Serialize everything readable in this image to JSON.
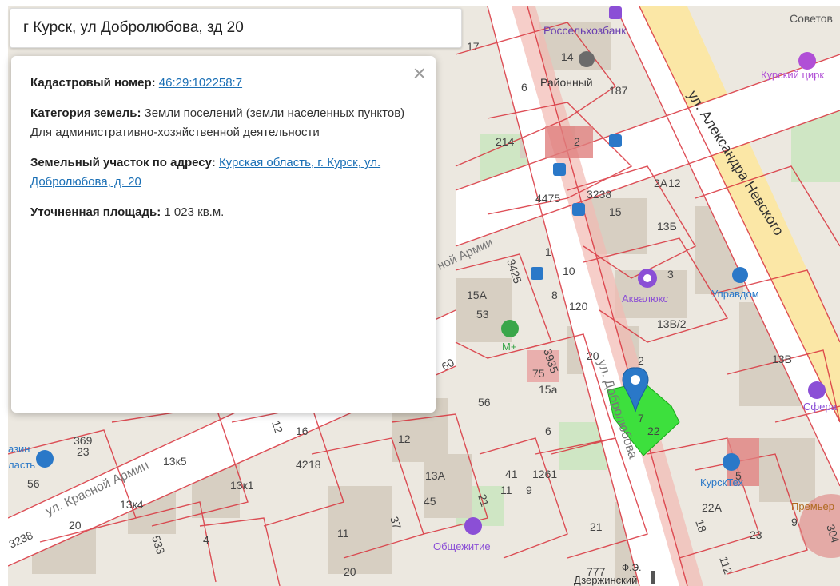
{
  "search": {
    "value": "г Курск, ул Добролюбова, зд 20"
  },
  "popup": {
    "close_symbol": "×",
    "cadastral_label": "Кадастровый номер:",
    "cadastral_value": "46:29:102258:7",
    "category_label": "Категория земель:",
    "category_value": "Земли поселений (земли населенных пунктов)",
    "usage_value": "Для административно-хозяйственной деятельности",
    "address_label": "Земельный участок по адресу:",
    "address_value": "Курская область, г. Курск, ул. Добролюбова, д. 20",
    "area_label": "Уточненная площадь:",
    "area_value": "1 023 кв.м."
  },
  "map": {
    "streets": {
      "nevsky": "ул. Александра Невского",
      "dobrolyubova": "ул. Добролюбова",
      "krasnoy_armii": "ул. Красной Армии",
      "krasnoy_armii_upper": "ной Армии"
    },
    "pois": {
      "rosselkhozbank": "Россельхозбанк",
      "raionny": "Районный",
      "sovetov": "Советов",
      "kursky_tsirk": "Курский цирк",
      "akvalyuks": "Аквалюкс",
      "upravdom": "Управдом",
      "m_plus": "М+",
      "obshchezhitie": "Общежитие",
      "sfera": "Сфера",
      "kursktekh": "КурскТех",
      "premier": "Премьер",
      "dzerzhinsky": "Дзержинский",
      "fe": "Ф.Э.",
      "magazin": "азин",
      "oblast": "ласть"
    },
    "numbers": [
      "17",
      "14",
      "6",
      "187",
      "214",
      "2",
      "4475",
      "3238",
      "2А",
      "12",
      "15",
      "13Б",
      "3",
      "3425",
      "1",
      "8",
      "10",
      "15А",
      "53",
      "120",
      "13В/2",
      "60",
      "75",
      "20",
      "2",
      "13В",
      "7",
      "22",
      "56",
      "15а",
      "16",
      "12",
      "6",
      "369",
      "23",
      "13к5",
      "42",
      "18",
      "21",
      "13А",
      "41",
      "11",
      "1261",
      "9",
      "56",
      "13к1",
      "13к4",
      "3238",
      "20",
      "11",
      "45",
      "21",
      "23",
      "5",
      "18",
      "22А",
      "9",
      "304",
      "533",
      "4",
      "20",
      "777",
      "112",
      "3935",
      "37",
      "12"
    ],
    "colors": {
      "parcel_highlight": "#3de03d",
      "marker": "#2a78c8",
      "boundary": "#d9323c"
    }
  }
}
